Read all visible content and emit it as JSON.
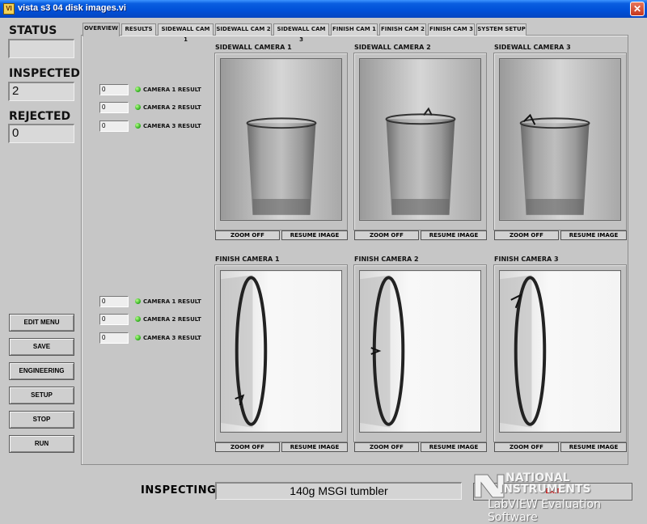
{
  "window": {
    "title": "vista s3 04 disk images.vi",
    "close_glyph": "✕",
    "icon_text": "VI"
  },
  "left_panel": {
    "status_label": "STATUS",
    "status_value": "",
    "inspected_label": "INSPECTED",
    "inspected_value": "2",
    "rejected_label": "REJECTED",
    "rejected_value": "0",
    "buttons": [
      "EDIT MENU",
      "SAVE",
      "ENGINEERING",
      "SETUP",
      "STOP",
      "RUN"
    ]
  },
  "tabs": [
    "OVERVIEW",
    "RESULTS",
    "SIDEWALL CAM 1",
    "SIDEWALL CAM 2",
    "SIDEWALL CAM 3",
    "FINISH CAM 1",
    "FINISH CAM 2",
    "FINISH CAM 3",
    "SYSTEM SETUP"
  ],
  "active_tab": "OVERVIEW",
  "sidewall_results": [
    {
      "value": "0",
      "label": "CAMERA 1 RESULT"
    },
    {
      "value": "0",
      "label": "CAMERA 2 RESULT"
    },
    {
      "value": "0",
      "label": "CAMERA 3 RESULT"
    }
  ],
  "finish_results": [
    {
      "value": "0",
      "label": "CAMERA 1 RESULT"
    },
    {
      "value": "0",
      "label": "CAMERA 2 RESULT"
    },
    {
      "value": "0",
      "label": "CAMERA 3 RESULT"
    }
  ],
  "cameras_top": [
    "SIDEWALL CAMERA 1",
    "SIDEWALL CAMERA 2",
    "SIDEWALL CAMERA 3"
  ],
  "cameras_bottom": [
    "FINISH CAMERA 1",
    "FINISH CAMERA 2",
    "FINISH CAMERA 3"
  ],
  "camera_buttons": {
    "zoom": "ZOOM OFF",
    "resume": "RESUME IMAGE"
  },
  "footer": {
    "inspecting_label": "INSPECTING",
    "inspecting_value": "140g MSGI tumbler",
    "exit_label": "EXIT",
    "ni_line1": "NATIONAL",
    "ni_line2": "INSTRUMENTS",
    "ni_line3": "LabVIEW  Evaluation Software"
  },
  "colors": {
    "led_on": "#2aa91a",
    "titlebar": "#0050d8",
    "panel_bg": "#c8c8c8"
  }
}
